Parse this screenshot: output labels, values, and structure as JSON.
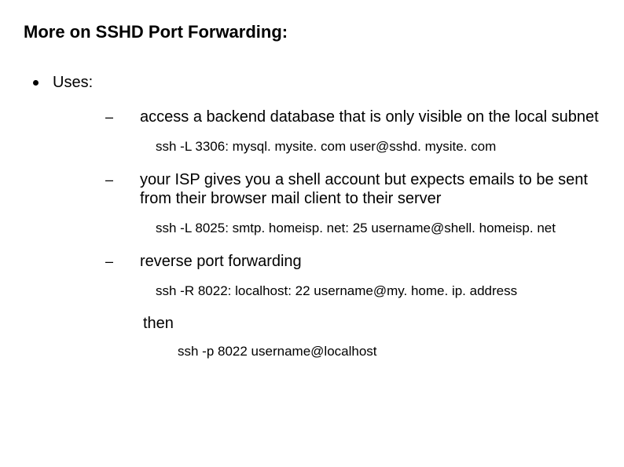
{
  "title": "More on SSHD Port Forwarding:",
  "uses_label": "Uses:",
  "items": [
    {
      "text": "access a backend database that is only visible on the local subnet",
      "code": "ssh -L 3306: mysql. mysite. com user@sshd. mysite. com"
    },
    {
      "text": "your ISP gives you a shell account but expects emails to be sent from their browser mail client to their server",
      "code": "ssh -L 8025: smtp. homeisp. net: 25 username@shell. homeisp. net"
    },
    {
      "text": "reverse port forwarding",
      "code": "ssh -R 8022: localhost: 22 username@my. home. ip. address"
    }
  ],
  "then_label": "then",
  "final_code": "ssh -p 8022 username@localhost"
}
